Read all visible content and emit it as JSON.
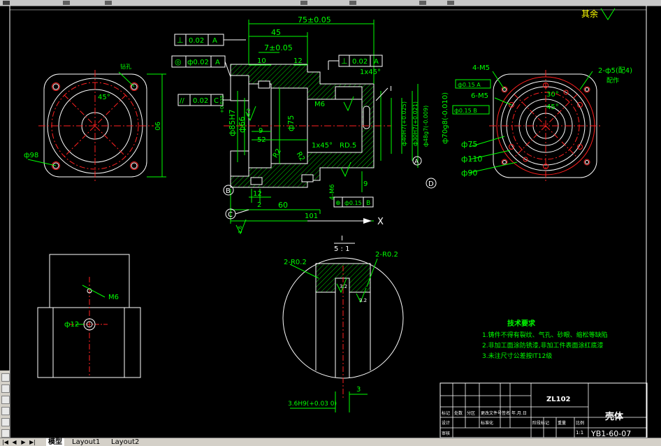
{
  "app": {
    "tabs": [
      "模型",
      "Layout1",
      "Layout2"
    ],
    "active_tab": "模型"
  },
  "drawing": {
    "roughness_note": "其余",
    "front_view": {
      "dim_overall": "75±0.05",
      "dim_45": "45",
      "dim_7": "7±0.05",
      "dim_10": "10",
      "dim_12": "12",
      "dim_chamfer_top": "1x45°",
      "dim_m6": "M6",
      "dim_9": "9",
      "dim_52": "52",
      "dim_phi75": "ф75",
      "dim_phi66": "ф66",
      "dim_phi85h7": "ф85H7",
      "dim_phi85_tol": "+0.035",
      "dim_phi40_1": "ф40H7(+0.025)",
      "dim_phi40_2": "ф30H7(+0.021)",
      "dim_phi48g7": "ф48g7(-0.009)",
      "dim_phi70g8": "ф70g8(-0.010)",
      "dim_chamfer_bottom": "1x45°",
      "dim_rd": "RD.5",
      "dim_r2": "R2",
      "dim_r2b": "R2",
      "dim_12b": "12",
      "dim_2": "2",
      "dim_9b": "9",
      "dim_4m6": "4-M6",
      "dim_60": "60",
      "dim_101": "101",
      "label_b": "B",
      "label_c": "C",
      "label_a": "A",
      "label_d": "D",
      "label_i": "I",
      "label_x": "X",
      "gtol_perp": {
        "symbol": "⊥",
        "value": "0.02",
        "datum": "A"
      },
      "gtol_conc": {
        "symbol": "◎",
        "value": "ф0.02",
        "datum": "A"
      },
      "gtol_para": {
        "symbol": "//",
        "value": "0.02",
        "datum": "C"
      },
      "gtol_right": {
        "symbol": "⊥",
        "value": "0.02",
        "datum": "A"
      },
      "gtol_bottom": {
        "symbol": "⊕",
        "value": "ф0.15",
        "datum": "B"
      },
      "rough_16": "1.6",
      "rough_32": "3.2"
    },
    "left_view": {
      "dim_90": "90",
      "dim_45deg": "45°",
      "dim_phi98": "ф98",
      "label_drill": "钻孔"
    },
    "right_view": {
      "label_4m5": "4-M5",
      "label_6m5": "6-M5",
      "label_2phi5": "2-ф5(配4)",
      "label_peizuo": "配作",
      "gtol_1": "ф0.15 A",
      "gtol_2": "ф0.15 B",
      "dim_30": "30°",
      "dim_45": "45°",
      "dim_phi75": "ф75",
      "dim_phi110": "ф110",
      "dim_phi90": "ф90"
    },
    "bottom_left_view": {
      "label_m6": "M6",
      "label_phi12": "ф12"
    },
    "detail_view": {
      "title": "I",
      "scale": "5 : 1",
      "label_r02_left": "2-R0.2",
      "label_r02_right": "2-R0.2",
      "rough_1": "3.2",
      "rough_2": "3.2",
      "dim_3": "3",
      "dim_hole": "3.6H9(+0.03 0)"
    },
    "tech_requirements": {
      "title": "技术要求",
      "items": [
        "1.铸件不得有裂纹、气孔、砂眼、缩松等缺陷",
        "2.非加工面涂防锈漆,非加工件表面涂红底漆",
        "3.未注尺寸公差按IT12级"
      ]
    },
    "title_block": {
      "material": "ZL102",
      "part_name": "壳体",
      "drawing_number": "YB1-60-07",
      "headers_row1": [
        "标记",
        "处数",
        "分区",
        "更改文件号",
        "签名",
        "年.月.日"
      ],
      "headers_row2": [
        "设计",
        "",
        "标准化"
      ],
      "headers_row3": [
        "阶段标记",
        "重量",
        "比例"
      ],
      "scale": "1:1",
      "review": "审核"
    }
  }
}
